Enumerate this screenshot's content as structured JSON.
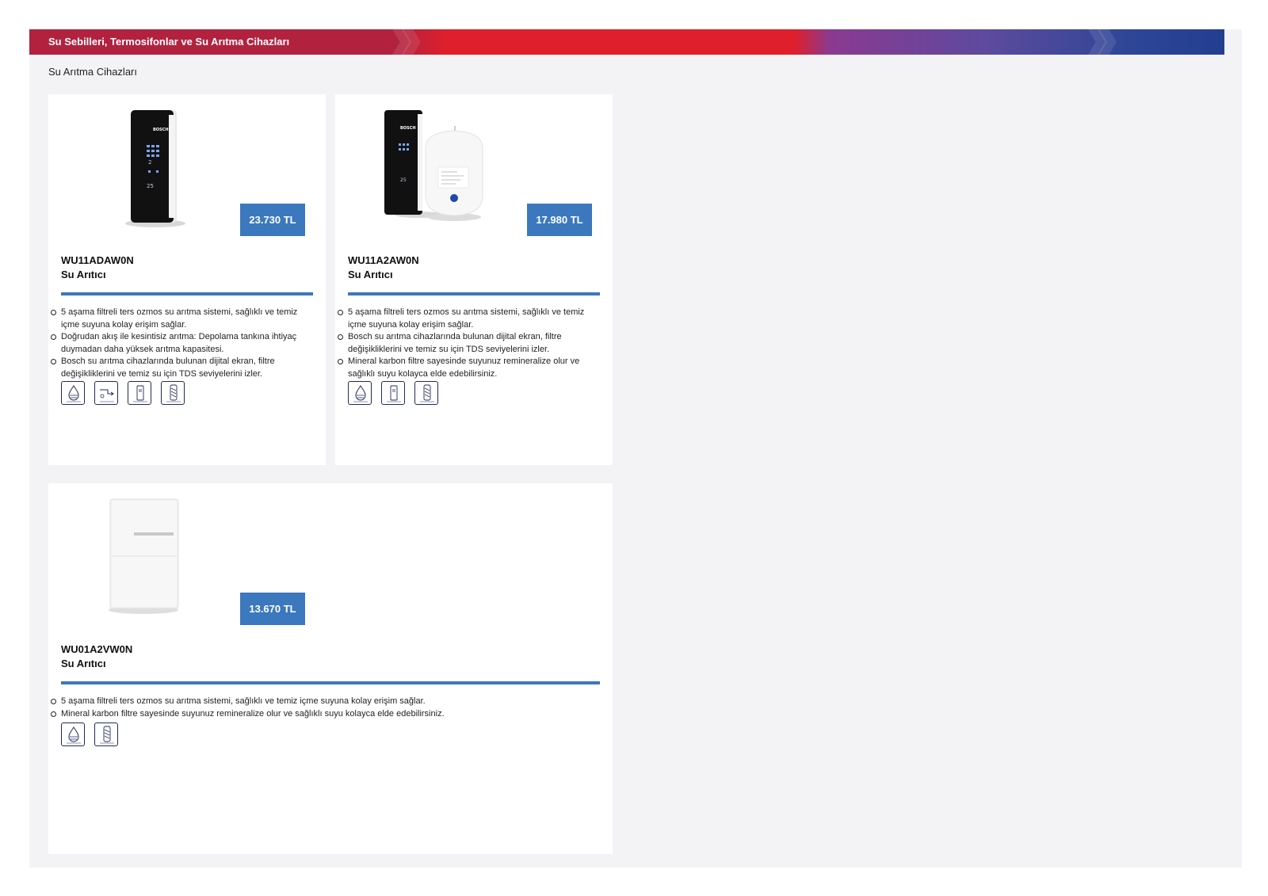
{
  "banner": {
    "title": "Su Sebilleri, Termosifonlar ve Su Arıtma Cihazları"
  },
  "section": {
    "title": "Su Arıtma Cihazları"
  },
  "products": [
    {
      "price": "23.730 TL",
      "model": "WU11ADAW0N",
      "type": "Su Arıtıcı",
      "features": [
        "5 aşama filtreli ters ozmos su arıtma sistemi, sağlıklı ve temiz içme suyuna kolay erişim sağlar.",
        "Doğrudan akış ile kesintisiz arıtma: Depolama tankına ihtiyaç duymadan daha yüksek arıtma kapasitesi.",
        "Bosch su arıtma cihazlarında bulunan dijital ekran, filtre değişikliklerini ve temiz su için TDS seviyelerini izler."
      ],
      "icons": [
        "ro-filter-icon",
        "direct-flow-icon",
        "digital-display-icon",
        "mineral-filter-icon"
      ]
    },
    {
      "price": "17.980 TL",
      "model": "WU11A2AW0N",
      "type": "Su Arıtıcı",
      "features": [
        "5 aşama filtreli ters ozmos su arıtma sistemi, sağlıklı ve temiz içme suyuna kolay erişim sağlar.",
        "Bosch su arıtma cihazlarında bulunan dijital ekran, filtre değişikliklerini ve temiz su için TDS seviyelerini izler.",
        "Mineral karbon filtre sayesinde suyunuz remineralize olur ve sağlıklı suyu kolayca elde edebilirsiniz."
      ],
      "icons": [
        "ro-filter-icon",
        "digital-display-icon",
        "mineral-filter-icon"
      ]
    },
    {
      "price": "13.670 TL",
      "model": "WU01A2VW0N",
      "type": "Su Arıtıcı",
      "features": [
        "5 aşama filtreli ters ozmos su arıtma sistemi, sağlıklı ve temiz içme suyuna kolay erişim sağlar.",
        "Mineral karbon filtre sayesinde suyunuz remineralize olur ve sağlıklı suyu kolayca elde edebilirsiniz."
      ],
      "icons": [
        "ro-filter-icon",
        "mineral-filter-icon"
      ]
    }
  ],
  "colors": {
    "accent": "#3b78be",
    "banner_red": "#df1f2b",
    "banner_blue": "#233e90"
  }
}
